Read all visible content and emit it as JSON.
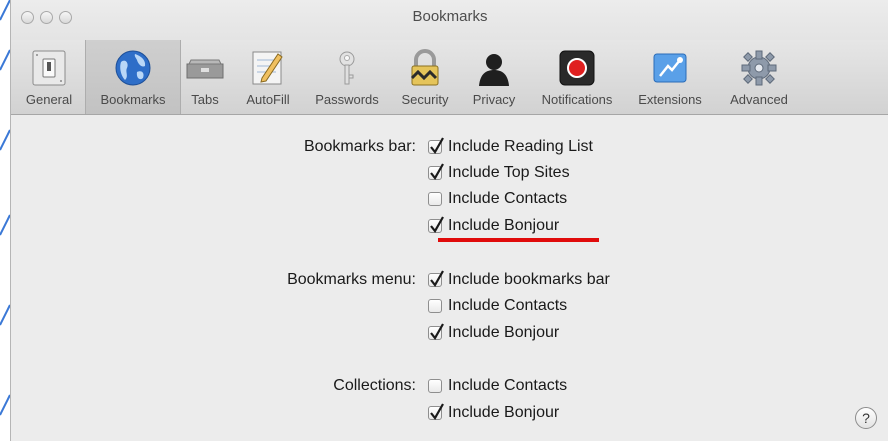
{
  "window": {
    "title": "Bookmarks"
  },
  "toolbar": {
    "items": [
      {
        "label": "General",
        "icon": "light-switch-icon"
      },
      {
        "label": "Bookmarks",
        "icon": "globe-icon",
        "active": true
      },
      {
        "label": "Tabs",
        "icon": "tabs-icon"
      },
      {
        "label": "AutoFill",
        "icon": "pencil-form-icon"
      },
      {
        "label": "Passwords",
        "icon": "key-icon"
      },
      {
        "label": "Security",
        "icon": "padlock-icon"
      },
      {
        "label": "Privacy",
        "icon": "silhouette-icon"
      },
      {
        "label": "Notifications",
        "icon": "record-icon"
      },
      {
        "label": "Extensions",
        "icon": "puzzle-icon"
      },
      {
        "label": "Advanced",
        "icon": "gear-icon"
      }
    ]
  },
  "sections": {
    "bookmarks_bar": {
      "label": "Bookmarks bar:",
      "options": [
        {
          "label": "Include Reading List",
          "checked": true
        },
        {
          "label": "Include Top Sites",
          "checked": true
        },
        {
          "label": "Include Contacts",
          "checked": false
        },
        {
          "label": "Include Bonjour",
          "checked": true
        }
      ]
    },
    "bookmarks_menu": {
      "label": "Bookmarks menu:",
      "options": [
        {
          "label": "Include bookmarks bar",
          "checked": true
        },
        {
          "label": "Include Contacts",
          "checked": false
        },
        {
          "label": "Include Bonjour",
          "checked": true
        }
      ]
    },
    "collections": {
      "label": "Collections:",
      "options": [
        {
          "label": "Include Contacts",
          "checked": false
        },
        {
          "label": "Include Bonjour",
          "checked": true
        }
      ]
    }
  },
  "help": {
    "label": "?"
  },
  "colors": {
    "accent_underline": "#e00b0b"
  }
}
